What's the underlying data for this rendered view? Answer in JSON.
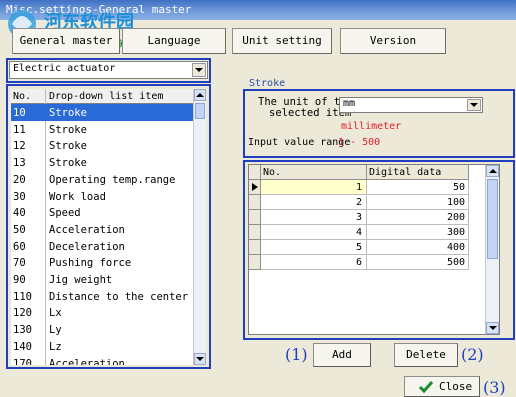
{
  "window": {
    "title": "Misc.settings-General master"
  },
  "watermark": {
    "text": "河东软件园",
    "url": "www.pc0359.cn"
  },
  "tabs": [
    {
      "label": "General master"
    },
    {
      "label": "Language"
    },
    {
      "label": "Unit setting"
    },
    {
      "label": "Version"
    }
  ],
  "category_select": {
    "value": "Electric actuator"
  },
  "list": {
    "headers": [
      "No.",
      "Drop-down list item"
    ],
    "selected_index": 0,
    "rows": [
      {
        "no": "10",
        "item": "Stroke"
      },
      {
        "no": "11",
        "item": "Stroke"
      },
      {
        "no": "12",
        "item": "Stroke"
      },
      {
        "no": "13",
        "item": "Stroke"
      },
      {
        "no": "20",
        "item": "Operating temp.range"
      },
      {
        "no": "30",
        "item": "Work load"
      },
      {
        "no": "40",
        "item": "Speed"
      },
      {
        "no": "50",
        "item": "Acceleration"
      },
      {
        "no": "60",
        "item": "Deceleration"
      },
      {
        "no": "70",
        "item": "Pushing force"
      },
      {
        "no": "90",
        "item": "Jig weight"
      },
      {
        "no": "110",
        "item": "Distance to the center of g"
      },
      {
        "no": "120",
        "item": "Lx"
      },
      {
        "no": "130",
        "item": "Ly"
      },
      {
        "no": "140",
        "item": "Lz"
      },
      {
        "no": "170",
        "item": "Acceleration"
      }
    ]
  },
  "detail": {
    "group_label": "Stroke",
    "unit_label_line1": "The unit of the",
    "unit_label_line2": "selected item",
    "unit_value": "mm",
    "unit_name": "millimeter",
    "range_label": "Input value range",
    "range_value": "1 - 500"
  },
  "grid": {
    "headers": [
      "No.",
      "Digital data"
    ],
    "rows": [
      {
        "no": "1",
        "value": "50"
      },
      {
        "no": "2",
        "value": "100"
      },
      {
        "no": "3",
        "value": "200"
      },
      {
        "no": "4",
        "value": "300"
      },
      {
        "no": "5",
        "value": "400"
      },
      {
        "no": "6",
        "value": "500"
      }
    ]
  },
  "buttons": {
    "add": "Add",
    "delete": "Delete",
    "close": "Close"
  },
  "callouts": {
    "c1": "(1)",
    "c2": "(2)",
    "c3": "(3)"
  },
  "colors": {
    "frame": "#1f3fbf",
    "selection": "#2a6ad6",
    "unit_name": "#e0202a",
    "range_value": "#e0202a",
    "check": "#1e8a2e"
  }
}
